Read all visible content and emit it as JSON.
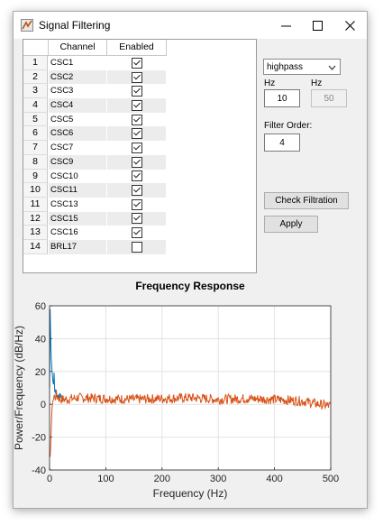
{
  "window": {
    "title": "Signal Filtering"
  },
  "table": {
    "headers": {
      "number": "",
      "channel": "Channel",
      "enabled": "Enabled"
    },
    "rows": [
      {
        "num": "1",
        "channel": "CSC1",
        "enabled": true
      },
      {
        "num": "2",
        "channel": "CSC2",
        "enabled": true
      },
      {
        "num": "3",
        "channel": "CSC3",
        "enabled": true
      },
      {
        "num": "4",
        "channel": "CSC4",
        "enabled": true
      },
      {
        "num": "5",
        "channel": "CSC5",
        "enabled": true
      },
      {
        "num": "6",
        "channel": "CSC6",
        "enabled": true
      },
      {
        "num": "7",
        "channel": "CSC7",
        "enabled": true
      },
      {
        "num": "8",
        "channel": "CSC9",
        "enabled": true
      },
      {
        "num": "9",
        "channel": "CSC10",
        "enabled": true
      },
      {
        "num": "10",
        "channel": "CSC11",
        "enabled": true
      },
      {
        "num": "11",
        "channel": "CSC13",
        "enabled": true
      },
      {
        "num": "12",
        "channel": "CSC15",
        "enabled": true
      },
      {
        "num": "13",
        "channel": "CSC16",
        "enabled": true
      },
      {
        "num": "14",
        "channel": "BRL17",
        "enabled": false
      }
    ]
  },
  "controls": {
    "filter_type": "highpass",
    "hz_label_1": "Hz",
    "hz_label_2": "Hz",
    "hz_value_1": "10",
    "hz_value_2": "50",
    "order_label": "Filter Order:",
    "order_value": "4",
    "check_button": "Check Filtration",
    "apply_button": "Apply"
  },
  "chart_data": {
    "type": "line",
    "title": "Frequency Response",
    "xlabel": "Frequency (Hz)",
    "ylabel": "Power/Frequency (dB/Hz)",
    "xlim": [
      0,
      500
    ],
    "ylim": [
      -40,
      60
    ],
    "xticks": [
      "0",
      "100",
      "200",
      "300",
      "400",
      "500"
    ],
    "yticks": [
      "60",
      "40",
      "20",
      "0",
      "-20",
      "-40"
    ],
    "grid": true,
    "colors": {
      "original": "#0072bd",
      "filtered": "#d95319"
    },
    "series": [
      {
        "color": "#0072bd",
        "x": [
          0,
          1,
          2,
          3,
          4,
          5,
          6,
          7,
          8,
          9,
          10,
          12,
          15,
          20
        ],
        "y": [
          10,
          58,
          40,
          28,
          22,
          18,
          14,
          12,
          20,
          9,
          8,
          6,
          5,
          5
        ]
      },
      {
        "color": "#d95319",
        "x": [
          0,
          1,
          2,
          3,
          4,
          5,
          6,
          8,
          10,
          12,
          15,
          20,
          30,
          50,
          100,
          150,
          200,
          250,
          300,
          350,
          400,
          450,
          480,
          500
        ],
        "y": [
          -30,
          -32,
          -25,
          -15,
          -5,
          0,
          2,
          5,
          4,
          6,
          4,
          3,
          3,
          4,
          3.5,
          3,
          3.5,
          4,
          3,
          3.5,
          3,
          2,
          0,
          -1
        ]
      }
    ]
  }
}
